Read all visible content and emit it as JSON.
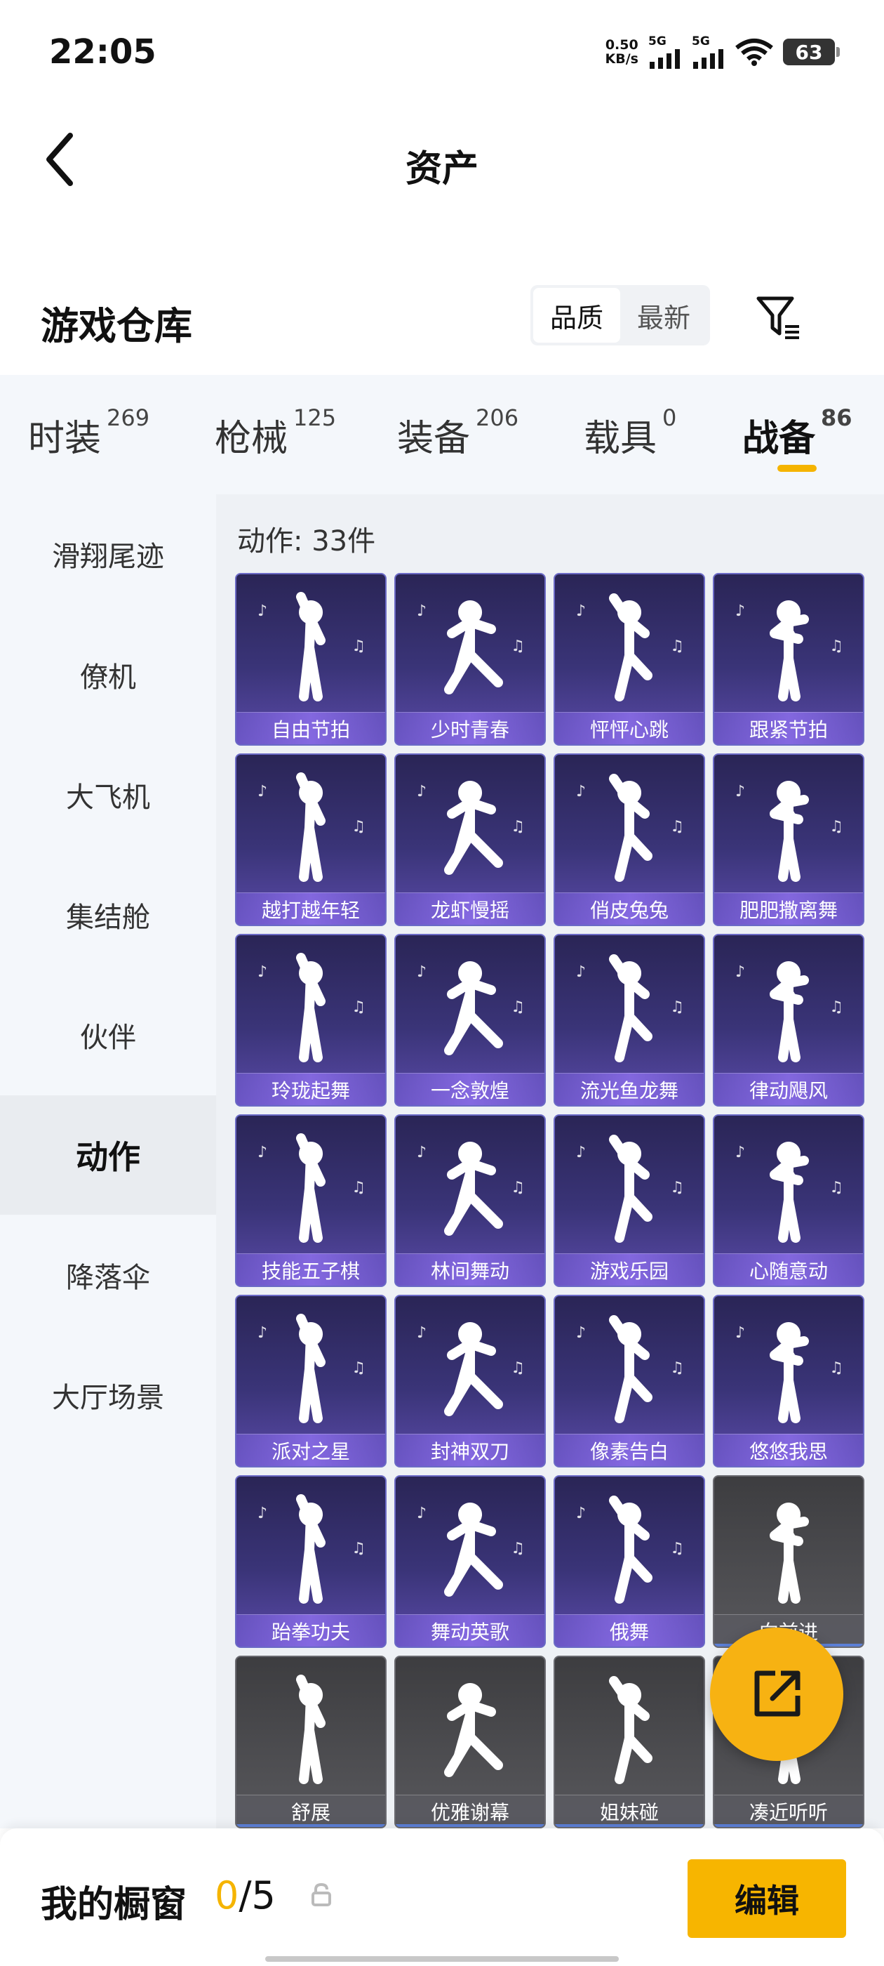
{
  "status_bar": {
    "time": "22:05",
    "net_speed_value": "0.50",
    "net_speed_unit": "KB/s",
    "sim1": "5G",
    "sim2": "5G",
    "battery": "63"
  },
  "nav": {
    "title": "资产"
  },
  "section": {
    "title": "游戏仓库",
    "sort_options": [
      "品质",
      "最新"
    ],
    "sort_active": "品质"
  },
  "category_tabs": [
    {
      "label": "时装",
      "count": "269"
    },
    {
      "label": "枪械",
      "count": "125"
    },
    {
      "label": "装备",
      "count": "206"
    },
    {
      "label": "载具",
      "count": "0"
    },
    {
      "label": "战备",
      "count": "86",
      "active": true
    }
  ],
  "sidebar": {
    "items": [
      "滑翔尾迹",
      "僚机",
      "大飞机",
      "集结舱",
      "伙伴",
      "动作",
      "降落伞",
      "大厅场景"
    ],
    "active": "动作"
  },
  "content": {
    "count_label": "动作: 33件",
    "items": [
      {
        "name": "自由节拍",
        "owned": true
      },
      {
        "name": "少时青春",
        "owned": true
      },
      {
        "name": "怦怦心跳",
        "owned": true
      },
      {
        "name": "跟紧节拍",
        "owned": true
      },
      {
        "name": "越打越年轻",
        "owned": true
      },
      {
        "name": "龙虾慢摇",
        "owned": true
      },
      {
        "name": "俏皮兔兔",
        "owned": true
      },
      {
        "name": "肥肥撒离舞",
        "owned": true
      },
      {
        "name": "玲珑起舞",
        "owned": true
      },
      {
        "name": "一念敦煌",
        "owned": true
      },
      {
        "name": "流光鱼龙舞",
        "owned": true
      },
      {
        "name": "律动飓风",
        "owned": true
      },
      {
        "name": "技能五子棋",
        "owned": true
      },
      {
        "name": "林间舞动",
        "owned": true
      },
      {
        "name": "游戏乐园",
        "owned": true
      },
      {
        "name": "心随意动",
        "owned": true
      },
      {
        "name": "派对之星",
        "owned": true
      },
      {
        "name": "封神双刀",
        "owned": true
      },
      {
        "name": "像素告白",
        "owned": true
      },
      {
        "name": "悠悠我思",
        "owned": true
      },
      {
        "name": "跆拳功夫",
        "owned": true
      },
      {
        "name": "舞动英歌",
        "owned": true
      },
      {
        "name": "俄舞",
        "owned": true
      },
      {
        "name": "向前进",
        "owned": false
      },
      {
        "name": "舒展",
        "owned": false
      },
      {
        "name": "优雅谢幕",
        "owned": false
      },
      {
        "name": "姐妹碰",
        "owned": false
      },
      {
        "name": "凑近听听",
        "owned": false
      }
    ]
  },
  "bottom_bar": {
    "showcase_title": "我的橱窗",
    "showcase_current": "0",
    "showcase_sep_total": "/5",
    "edit_label": "编辑"
  },
  "colors": {
    "accent": "#f5b400",
    "card_purple": "#3a3478",
    "card_gray": "#58585c"
  },
  "icons": [
    "back-arrow-icon",
    "filter-icon",
    "lock-icon",
    "share-export-icon",
    "wifi-icon",
    "signal-icon",
    "battery-icon"
  ]
}
